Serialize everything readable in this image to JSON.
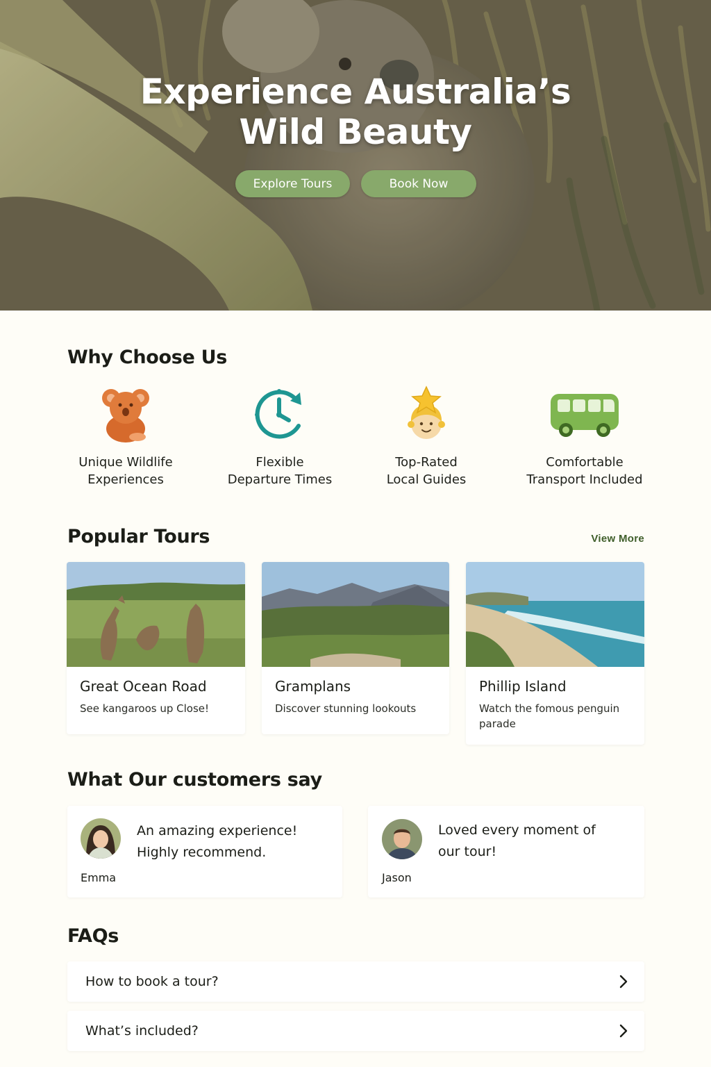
{
  "hero": {
    "title_line1": "Experience Australia’s",
    "title_line2": "Wild Beauty",
    "explore_label": "Explore Tours",
    "book_label": "Book Now"
  },
  "why": {
    "title": "Why Choose Us",
    "features": [
      {
        "icon": "koala-icon",
        "line1": "Unique Wildlife",
        "line2": "Experiences"
      },
      {
        "icon": "clock-icon",
        "line1": "Flexible",
        "line2": "Departure Times"
      },
      {
        "icon": "guide-star-icon",
        "line1": "Top-Rated",
        "line2": "Local Guides"
      },
      {
        "icon": "bus-icon",
        "line1": "Comfortable",
        "line2": "Transport Included"
      }
    ]
  },
  "tours": {
    "title": "Popular Tours",
    "view_more": "View More",
    "items": [
      {
        "title": "Great Ocean Road",
        "desc": "See kangaroos up Close!",
        "photo": "kangaroos-photo"
      },
      {
        "title": "Gramplans",
        "desc": "Discover stunning lookouts",
        "photo": "mountains-photo"
      },
      {
        "title": "Phillip Island",
        "desc": "Watch the fomous penguin parade",
        "photo": "beach-photo"
      }
    ]
  },
  "testimonials": {
    "title": "What Our customers say",
    "items": [
      {
        "line1": "An amazing experience!",
        "line2": "Highly recommend.",
        "author": "Emma"
      },
      {
        "line1": "Loved every moment of",
        "line2": "our tour!",
        "author": "Jason"
      }
    ]
  },
  "faqs": {
    "title": "FAQs",
    "items": [
      {
        "question": "How to book a tour?"
      },
      {
        "question": "What’s included?"
      }
    ]
  },
  "colors": {
    "accent": "#88a96b",
    "link": "#3f5e2a",
    "background": "#fefdf7"
  }
}
